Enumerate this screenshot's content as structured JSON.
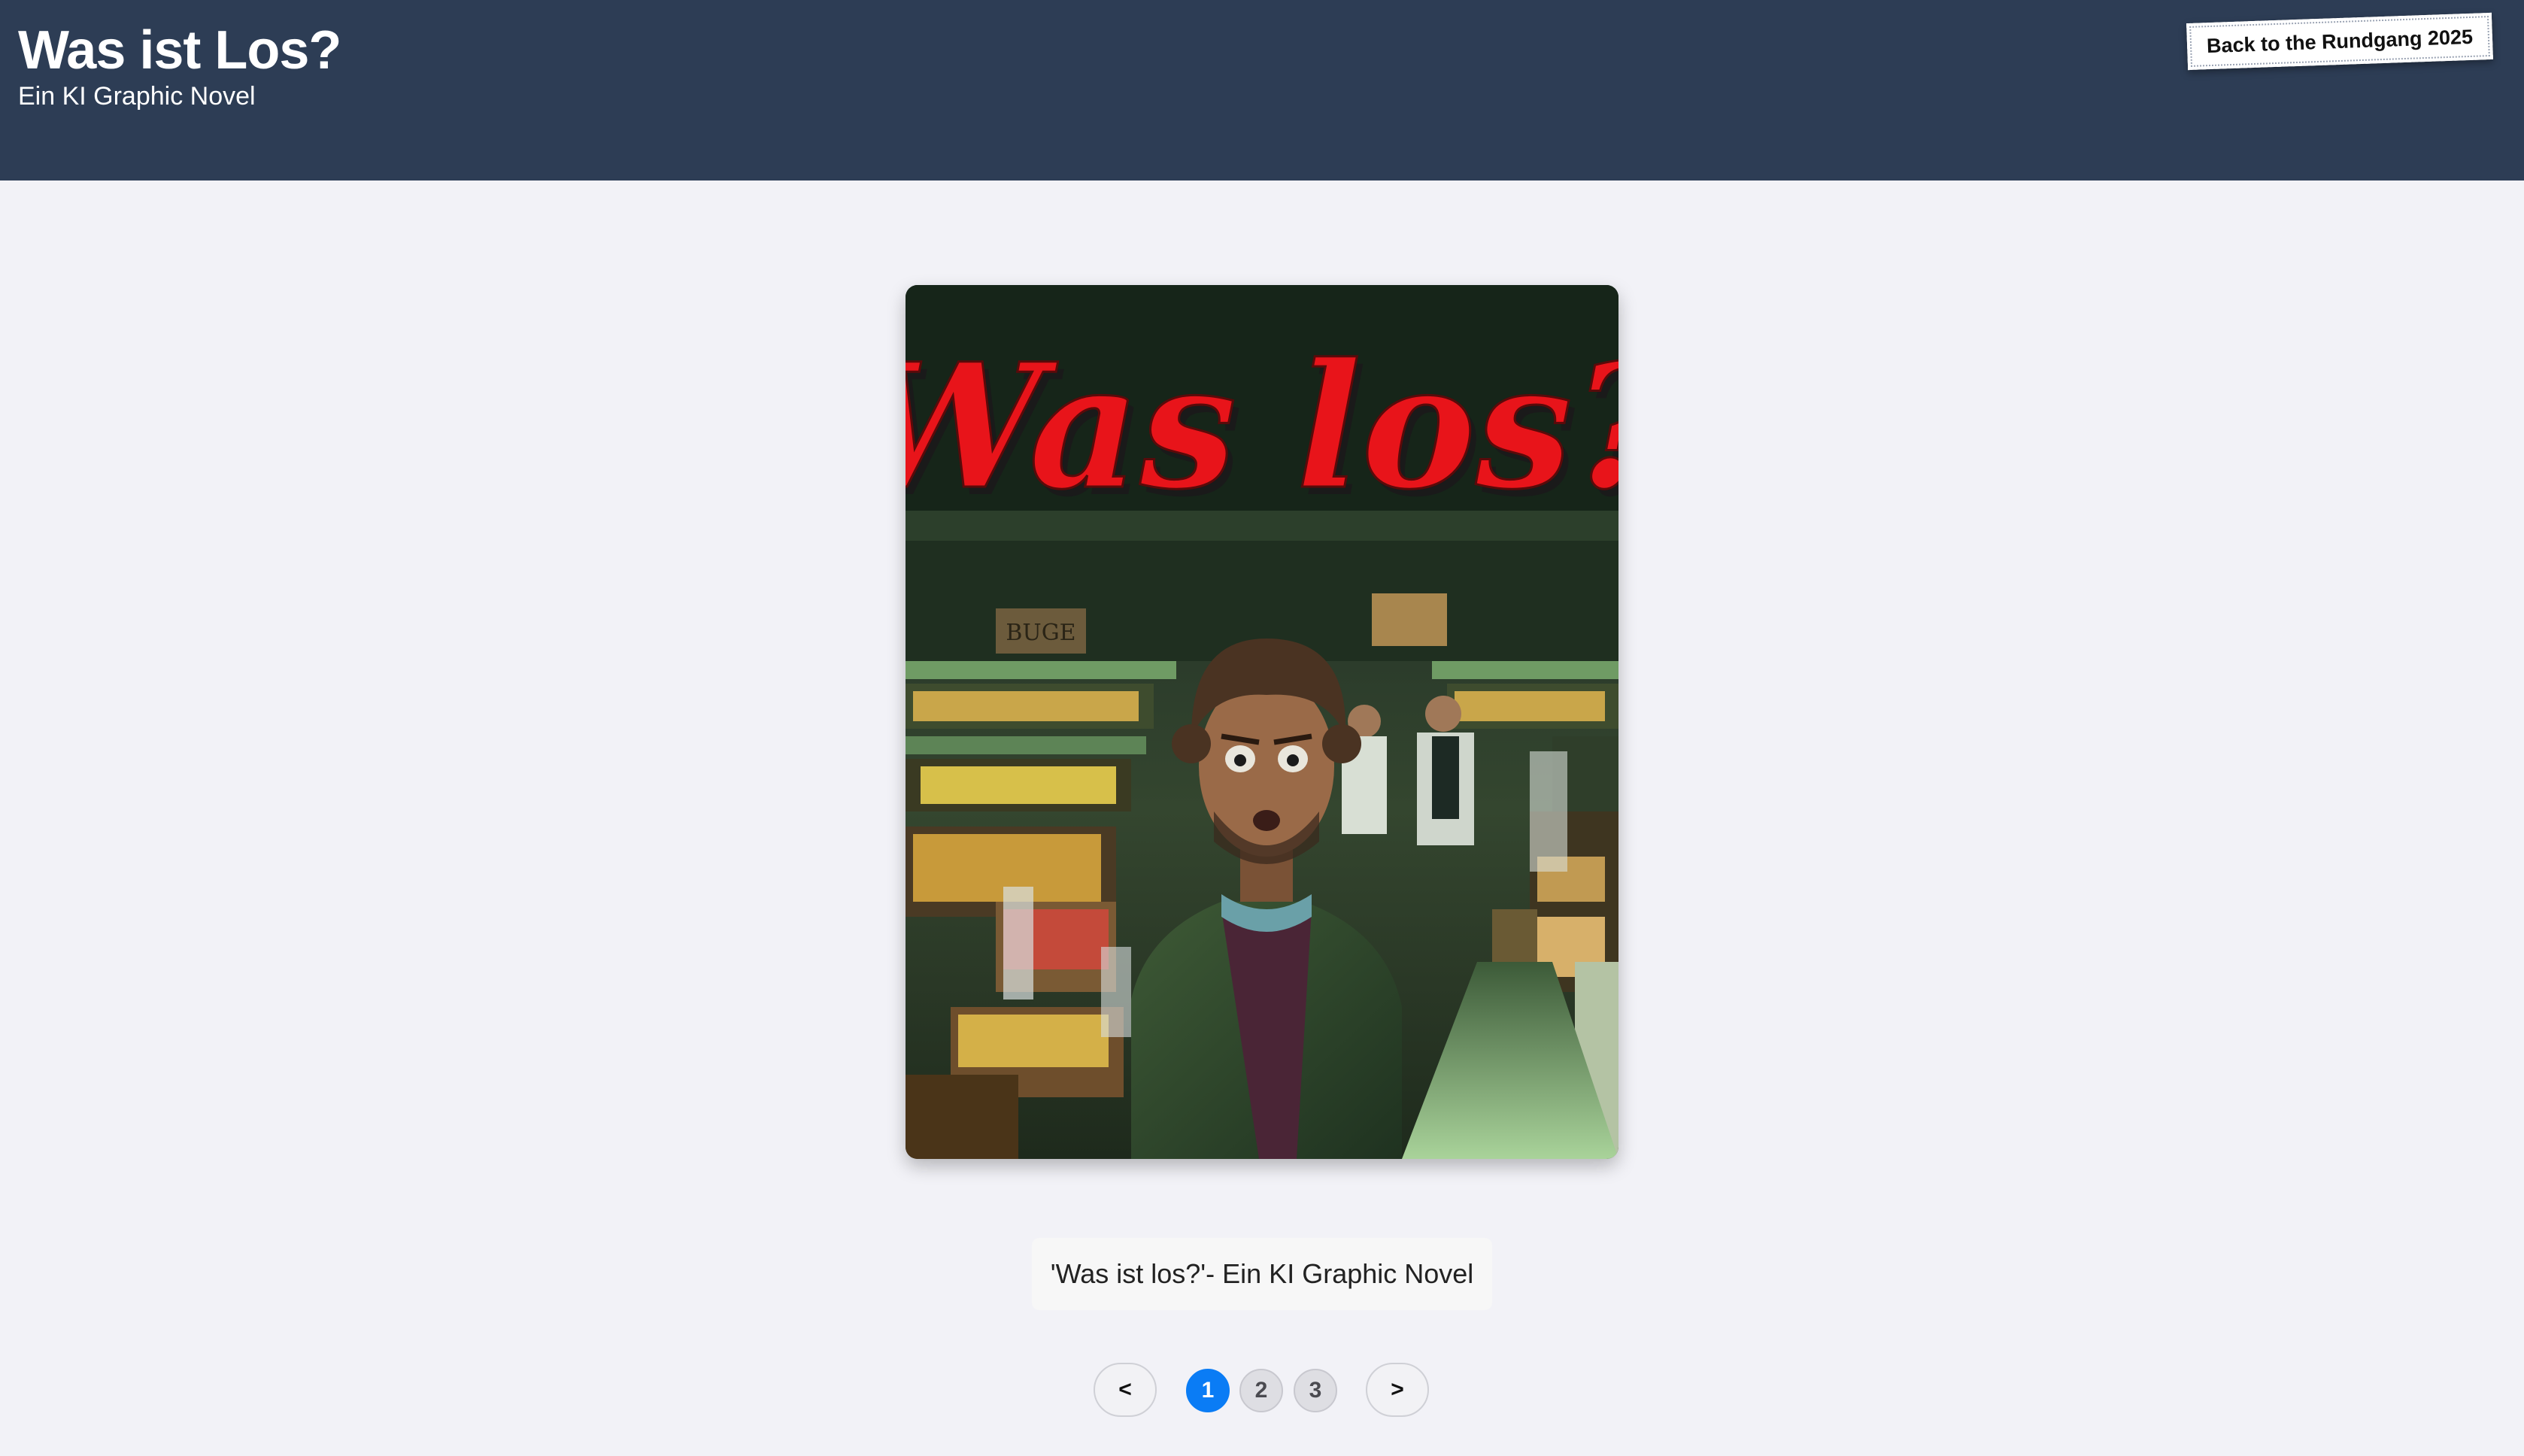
{
  "header": {
    "title": "Was ist Los?",
    "subtitle": "Ein KI Graphic Novel",
    "back_button_label": "Back to the Rundgang 2025"
  },
  "cover": {
    "title_text": "Was los?",
    "sign_text": "BUGE"
  },
  "caption": "'Was ist los?'- Ein KI Graphic Novel",
  "pagination": {
    "prev_label": "<",
    "next_label": ">",
    "pages": [
      "1",
      "2",
      "3"
    ],
    "current_page": "1"
  },
  "colors": {
    "header_bg": "#2d3d55",
    "page_bg": "#f2f2f7",
    "active_page": "#0a7cf5",
    "cover_title": "#e8141a"
  }
}
